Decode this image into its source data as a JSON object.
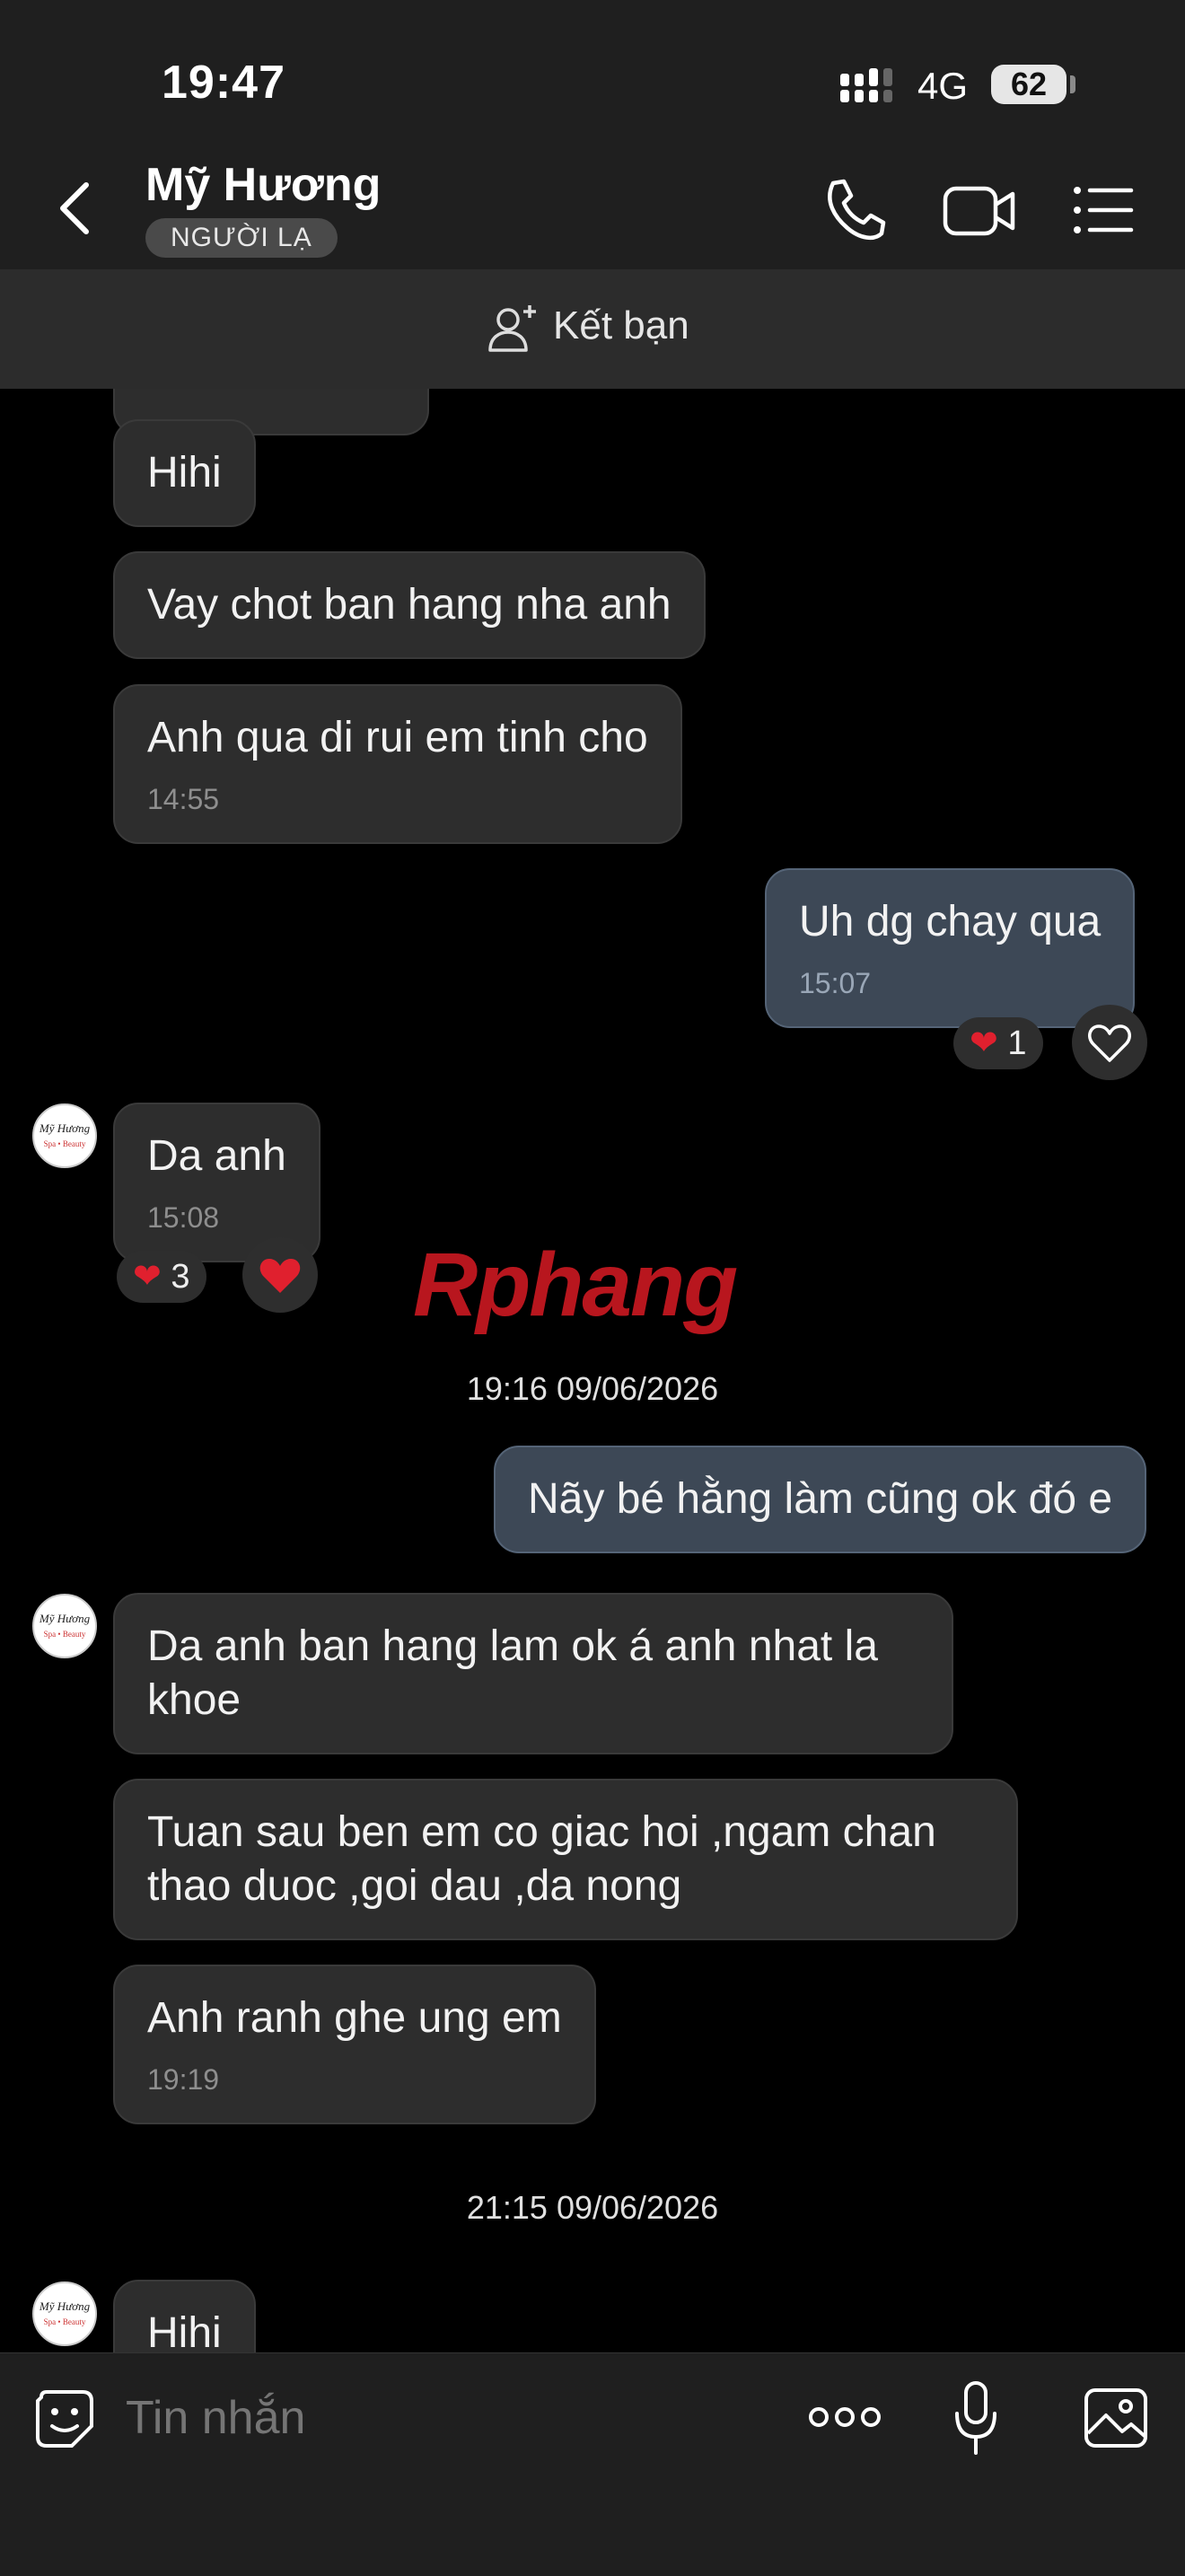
{
  "status_bar": {
    "time": "19:47",
    "network": "4G",
    "battery": "62"
  },
  "header": {
    "contact_name": "Mỹ Hương",
    "badge": "NGƯỜI LẠ"
  },
  "friend_bar": {
    "label": "Kết bạn"
  },
  "avatar": {
    "line1": "Mỹ Hương",
    "line2": "Spa • Beauty"
  },
  "messages": [
    {
      "text": "Hihi"
    },
    {
      "text": "Vay chot ban hang nha anh"
    },
    {
      "text": "Anh qua di rui em tinh cho",
      "time": "14:55"
    },
    {
      "text": "Uh dg chay qua",
      "time": "15:07",
      "reaction_count": "1"
    },
    {
      "text": "Da anh",
      "time": "15:08",
      "reaction_count": "3"
    },
    {
      "text": "Nãy bé hằng làm cũng ok đó e"
    },
    {
      "text": "Da anh ban hang lam ok á anh nhat la khoe"
    },
    {
      "text": "Tuan sau ben em co giac hoi ,ngam chan thao duoc ,goi dau ,da nong"
    },
    {
      "text": "Anh ranh ghe ung em",
      "time": "19:19"
    },
    {
      "text": "Hihi"
    }
  ],
  "date_separators": [
    "19:16 09/06/2026",
    "21:15 09/06/2026"
  ],
  "watermark": {
    "text": "Rphang"
  },
  "input": {
    "placeholder": "Tin nhắn"
  },
  "colors": {
    "outgoing_bubble": "#3d4856",
    "incoming_bubble": "#2d2d2d",
    "heart": "#e0202e"
  }
}
